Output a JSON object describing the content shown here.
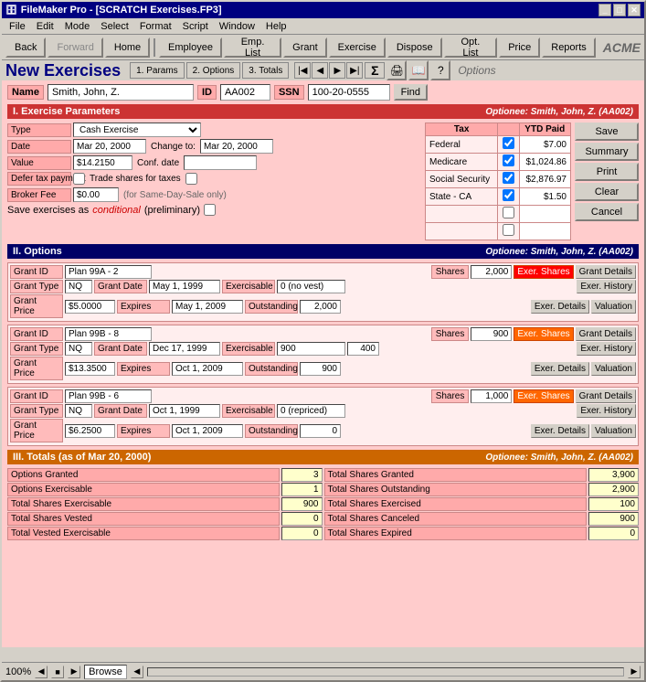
{
  "window": {
    "title": "FileMaker Pro - [SCRATCH Exercises.FP3]"
  },
  "menu": {
    "items": [
      "File",
      "Edit",
      "Mode",
      "Select",
      "Format",
      "Script",
      "Window",
      "Help"
    ]
  },
  "toolbar": {
    "back": "Back",
    "forward": "Forward",
    "home": "Home",
    "employee": "Employee",
    "emp_list": "Emp. List",
    "grant": "Grant",
    "exercise": "Exercise",
    "dispose": "Dispose",
    "opt_list": "Opt. List",
    "price": "Price",
    "reports": "Reports",
    "acme": "ACME"
  },
  "tabs": {
    "title": "New Exercises",
    "tab1": "1. Params",
    "tab2": "2. Options",
    "tab3": "3. Totals",
    "options_label": "Options"
  },
  "name_row": {
    "name_label": "Name",
    "name_value": "Smith, John, Z.",
    "id_label": "ID",
    "id_value": "AA002",
    "ssn_label": "SSN",
    "ssn_value": "100-20-0555",
    "find_btn": "Find"
  },
  "section1": {
    "title": "I. Exercise Parameters",
    "optionee": "Optionee: Smith, John, Z. (AA002)"
  },
  "exercise_params": {
    "type_label": "Type",
    "type_value": "Cash Exercise",
    "date_label": "Date",
    "date_value": "Mar 20, 2000",
    "change_to_label": "Change to:",
    "change_to_value": "Mar 20, 2000",
    "value_label": "Value",
    "value_value": "$14.2150",
    "conf_date_label": "Conf. date",
    "defer_label": "Defer tax payment",
    "trade_label": "Trade shares for taxes",
    "broker_label": "Broker Fee",
    "broker_value": "$0.00",
    "broker_note": "(for Same-Day-Sale only)",
    "conditional_text": "Save exercises as",
    "conditional_link": "conditional",
    "conditional_note": "(preliminary)"
  },
  "tax_table": {
    "col1": "Tax",
    "col2": "YTD Paid",
    "rows": [
      {
        "tax": "Federal",
        "checked": true,
        "ytd": "$7.00"
      },
      {
        "tax": "Medicare",
        "checked": true,
        "ytd": "$1,024.86"
      },
      {
        "tax": "Social Security",
        "checked": true,
        "ytd": "$2,876.97"
      },
      {
        "tax": "State - CA",
        "checked": true,
        "ytd": "$1.50"
      },
      {
        "tax": "",
        "checked": false,
        "ytd": ""
      },
      {
        "tax": "",
        "checked": false,
        "ytd": ""
      }
    ]
  },
  "actions": {
    "save": "Save",
    "summary": "Summary",
    "print": "Print",
    "clear": "Clear",
    "cancel": "Cancel"
  },
  "section2": {
    "title": "II. Options",
    "optionee": "Optionee: Smith, John, Z. (AA002)"
  },
  "grants": [
    {
      "grant_id_label": "Grant ID",
      "grant_id_value": "Plan 99A - 2",
      "shares_label": "Shares",
      "shares_value": "2,000",
      "exer_shares_btn": "Exer. Shares",
      "grant_details_btn": "Grant Details",
      "type_label": "Grant Type",
      "type_value": "NQ",
      "grant_date_label": "Grant Date",
      "grant_date_value": "May 1, 1999",
      "exercisable_label": "Exercisable",
      "exercisable_value": "0 (no vest)",
      "exer_history_btn": "Exer. History",
      "price_label": "Grant Price",
      "price_value": "$5.0000",
      "expires_label": "Expires",
      "expires_value": "May 1, 2009",
      "outstanding_label": "Outstanding",
      "outstanding_value": "2,000",
      "exer_details_btn": "Exer. Details",
      "valuation_btn": "Valuation"
    },
    {
      "grant_id_label": "Grant ID",
      "grant_id_value": "Plan 99B - 8",
      "shares_label": "Shares",
      "shares_value": "900",
      "exer_shares_btn": "Exer. Shares",
      "grant_details_btn": "Grant Details",
      "type_label": "Grant Type",
      "type_value": "NQ",
      "grant_date_label": "Grant Date",
      "grant_date_value": "Dec 17, 1999",
      "exercisable_label": "Exercisable",
      "exercisable_value": "900",
      "exercisable_value2": "400",
      "exer_history_btn": "Exer. History",
      "price_label": "Grant Price",
      "price_value": "$13.3500",
      "expires_label": "Expires",
      "expires_value": "Oct 1, 2009",
      "outstanding_label": "Outstanding",
      "outstanding_value": "900",
      "exer_details_btn": "Exer. Details",
      "valuation_btn": "Valuation"
    },
    {
      "grant_id_label": "Grant ID",
      "grant_id_value": "Plan 99B - 6",
      "shares_label": "Shares",
      "shares_value": "1,000",
      "exer_shares_btn": "Exer. Shares",
      "grant_details_btn": "Grant Details",
      "type_label": "Grant Type",
      "type_value": "NQ",
      "grant_date_label": "Grant Date",
      "grant_date_value": "Oct 1, 1999",
      "exercisable_label": "Exercisable",
      "exercisable_value": "0 (repriced)",
      "exer_history_btn": "Exer. History",
      "price_label": "Grant Price",
      "price_value": "$6.2500",
      "expires_label": "Expires",
      "expires_value": "Oct 1, 2009",
      "outstanding_label": "Outstanding",
      "outstanding_value": "0",
      "exer_details_btn": "Exer. Details",
      "valuation_btn": "Valuation"
    }
  ],
  "section3": {
    "title": "III. Totals (as of Mar 20, 2000)",
    "optionee": "Optionee: Smith, John, Z. (AA002)"
  },
  "totals_left": [
    {
      "label": "Options Granted",
      "value": "3"
    },
    {
      "label": "Options Exercisable",
      "value": "1"
    },
    {
      "label": "Total Shares Exercisable",
      "value": "900"
    },
    {
      "label": "Total Shares Vested",
      "value": "0"
    },
    {
      "label": "Total Vested Exercisable",
      "value": "0"
    }
  ],
  "totals_right": [
    {
      "label": "Total Shares Granted",
      "value": "3,900"
    },
    {
      "label": "Total Shares Outstanding",
      "value": "2,900"
    },
    {
      "label": "Total Shares Exercised",
      "value": "100"
    },
    {
      "label": "Total Shares Canceled",
      "value": "900"
    },
    {
      "label": "Total Shares Expired",
      "value": "0"
    }
  ],
  "status_bar": {
    "zoom": "100%",
    "mode": "Browse"
  }
}
